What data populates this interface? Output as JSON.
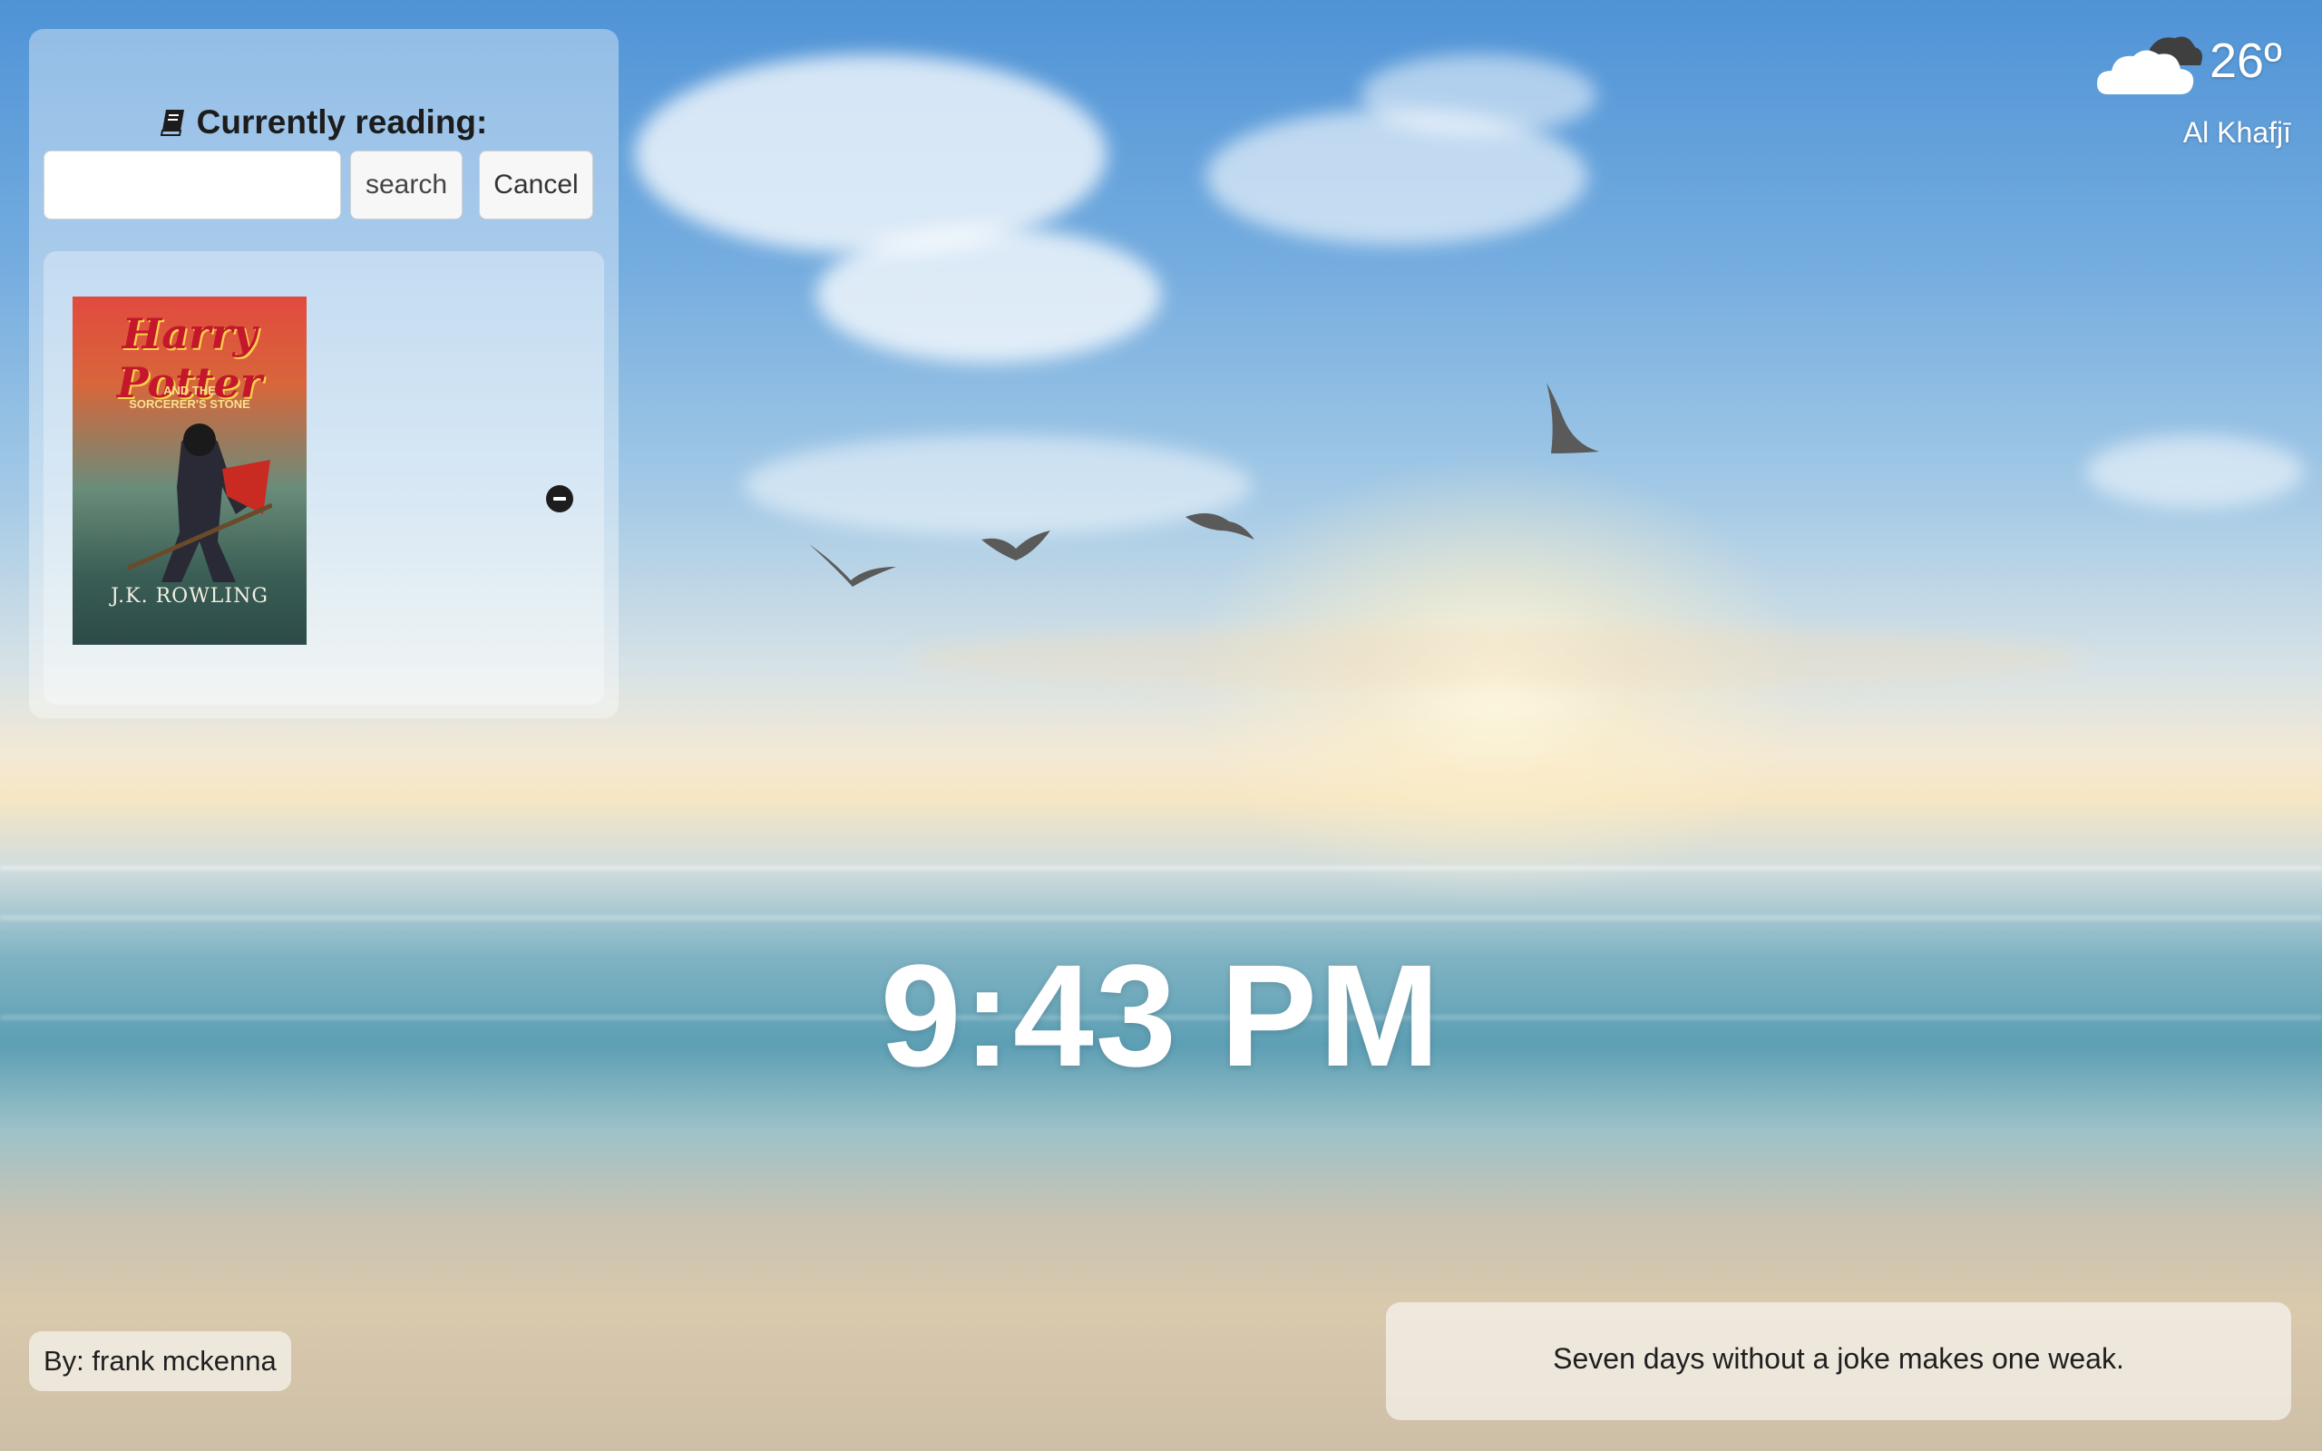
{
  "reading": {
    "title": "Currently reading:",
    "search_input_value": "",
    "search_label": "search",
    "cancel_label": "Cancel",
    "books": [
      {
        "cover_title": "Harry Potter",
        "cover_subtitle_line1": "AND THE",
        "cover_subtitle_line2": "SORCERER'S STONE",
        "cover_author": "J.K. ROWLING",
        "remove_icon": "minus-circle-icon"
      }
    ]
  },
  "weather": {
    "icon": "cloud-icon",
    "temperature": "26º",
    "city": "Al Khafjī"
  },
  "clock": {
    "time": "9:43 PM"
  },
  "photo_credit": {
    "text": "By: frank mckenna"
  },
  "quote": {
    "text": "Seven days without a joke makes one weak."
  },
  "colors": {
    "panel_bg": "rgba(255,255,255,0.38)",
    "clock_text": "#ffffff"
  }
}
